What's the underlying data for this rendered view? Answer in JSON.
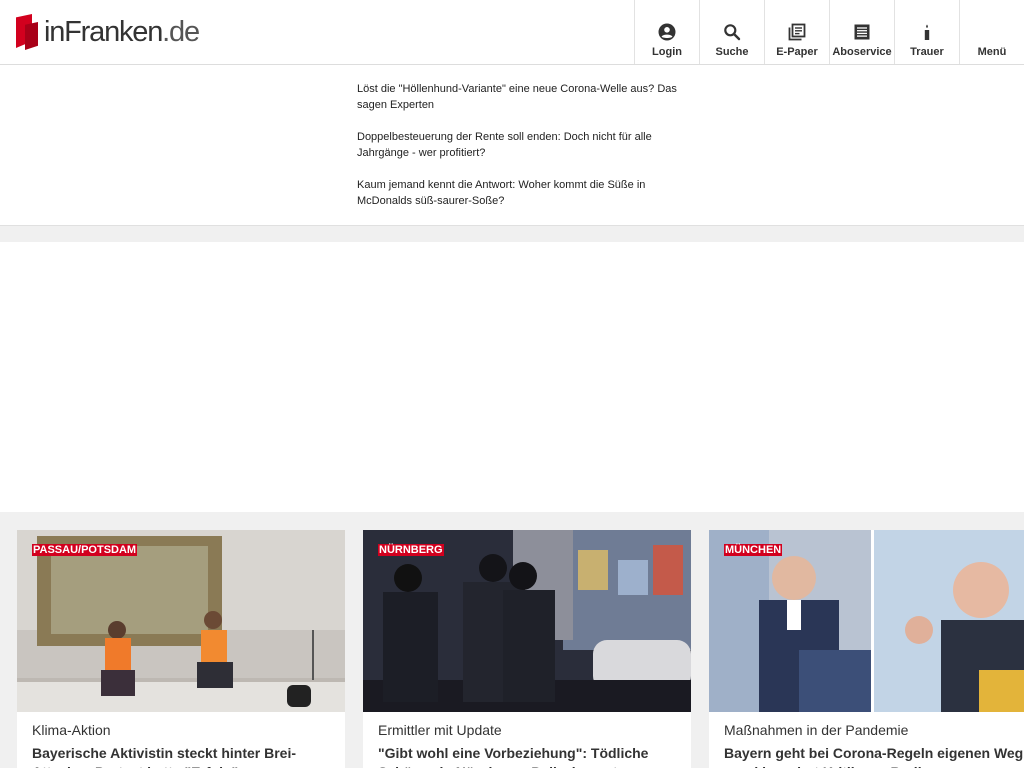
{
  "logo": {
    "name": "inFranken",
    "tld": ".de"
  },
  "nav": {
    "items": [
      {
        "label": "Login",
        "icon": "user-circle-icon"
      },
      {
        "label": "Suche",
        "icon": "search-icon"
      },
      {
        "label": "E-Paper",
        "icon": "epaper-icon"
      },
      {
        "label": "Aboservice",
        "icon": "list-icon"
      },
      {
        "label": "Trauer",
        "icon": "candle-icon"
      },
      {
        "label": "Menü",
        "icon": "menu-icon"
      }
    ]
  },
  "teasers": [
    "Löst die \"Höllenhund-Variante\" eine neue Corona-Welle aus? Das sagen Experten",
    "Doppelbesteuerung der Rente soll enden: Doch nicht für alle Jahrgänge - wer profitiert?",
    "Kaum jemand kennt die Antwort: Woher kommt die Süße in McDonalds süß-saurer-Soße?"
  ],
  "cards": [
    {
      "tag": "PASSAU/POTSDAM",
      "kicker": "Klima-Aktion",
      "title": "Bayerische Aktivistin steckt hinter Brei-Attacke - Protest hatte \"Erfolg\""
    },
    {
      "tag": "NÜRNBERG",
      "kicker": "Ermittler mit Update",
      "title": "\"Gibt wohl eine Vorbeziehung\": Tödliche Schüsse in Nürnberg - Polizei nennt neue Details"
    },
    {
      "tag": "MÜNCHEN",
      "kicker": "Maßnahmen in der Pandemie",
      "title": "Bayern geht bei Corona-Regeln eigenen Weg - und ignoriert Kritik aus Berlin"
    }
  ],
  "colors": {
    "brand_red": "#d2001e",
    "gray_bg": "#f0f0f0",
    "text": "#333333"
  }
}
